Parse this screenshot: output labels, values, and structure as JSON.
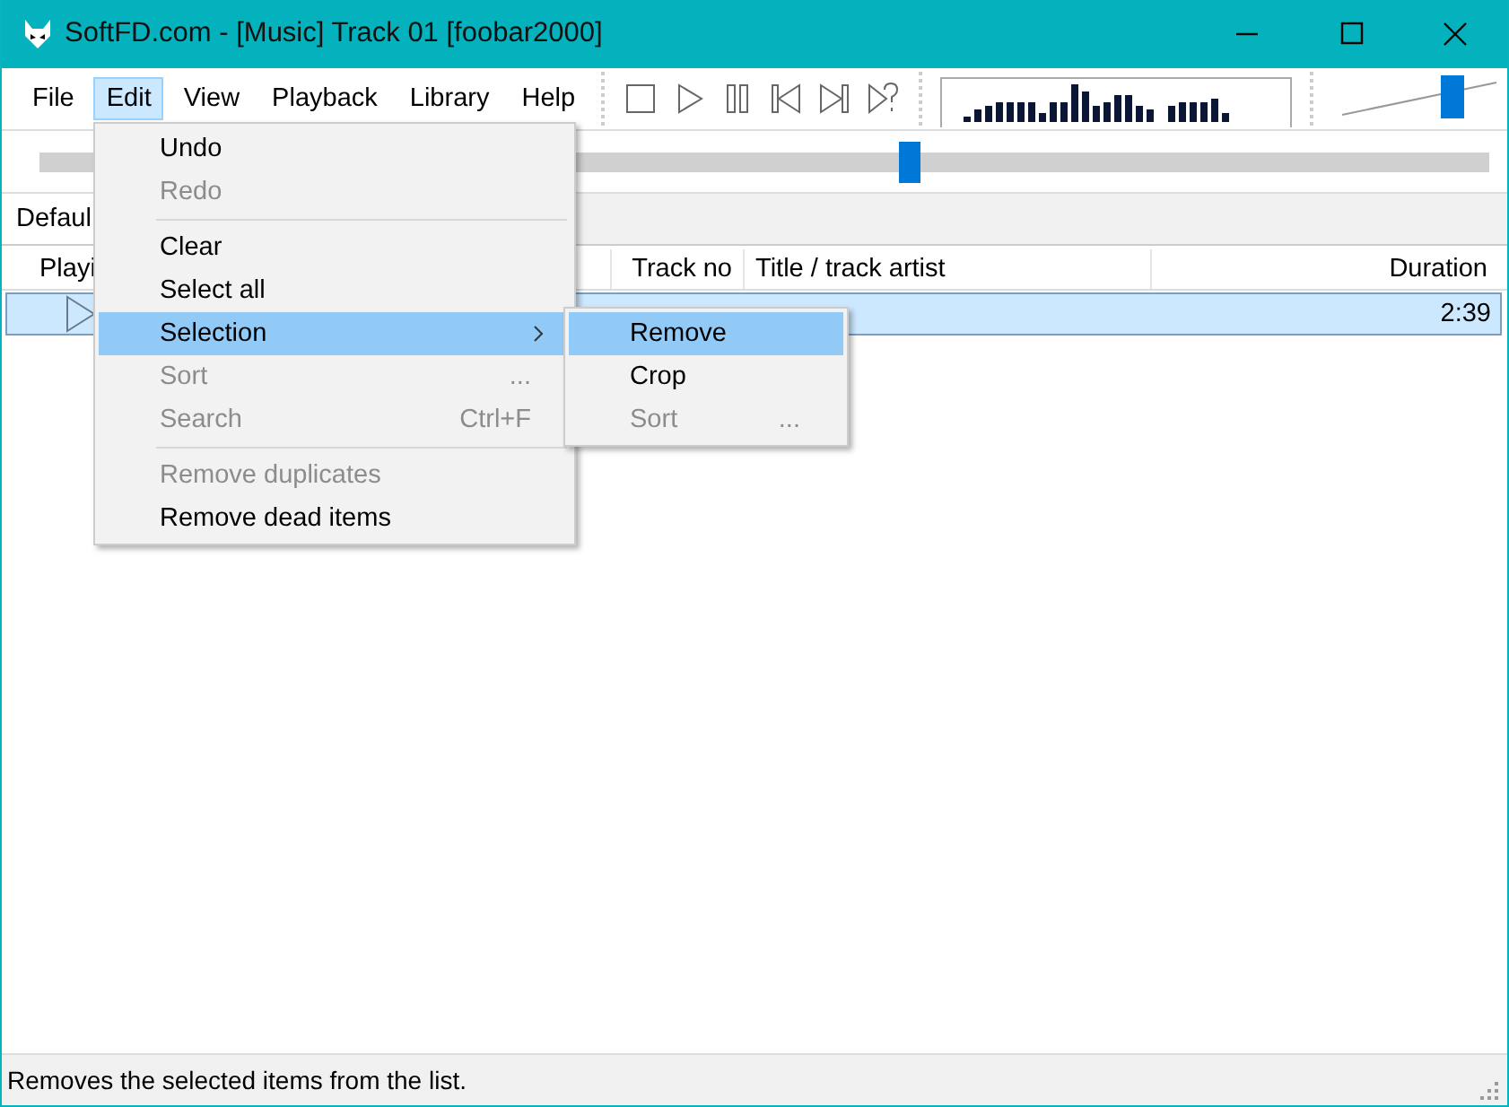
{
  "window": {
    "title": "SoftFD.com - [Music] Track 01  [foobar2000]"
  },
  "menu_bar": [
    {
      "label": "File",
      "selected": false
    },
    {
      "label": "Edit",
      "selected": true
    },
    {
      "label": "View",
      "selected": false
    },
    {
      "label": "Playback",
      "selected": false
    },
    {
      "label": "Library",
      "selected": false
    },
    {
      "label": "Help",
      "selected": false
    }
  ],
  "seek_bar": {
    "level": 0.6
  },
  "volume": {
    "level": 0.75
  },
  "playlist_tabs": [
    {
      "label": "Defaul",
      "selected": true
    }
  ],
  "columns": [
    "Playi",
    "Track no",
    "Title / track artist",
    "Duration"
  ],
  "rows": [
    {
      "selected": true,
      "playing": true,
      "duration": "2:39"
    }
  ],
  "edit_menu": [
    {
      "kind": "item",
      "label": "Undo",
      "disabled": false,
      "selected": false
    },
    {
      "kind": "item",
      "label": "Redo",
      "disabled": true,
      "selected": false
    },
    {
      "kind": "separator"
    },
    {
      "kind": "item",
      "label": "Clear",
      "disabled": false,
      "selected": false
    },
    {
      "kind": "item",
      "label": "Select all",
      "disabled": false,
      "selected": false
    },
    {
      "kind": "item",
      "label": "Selection",
      "disabled": false,
      "selected": true,
      "submenu": true
    },
    {
      "kind": "item",
      "label": "Sort",
      "shortcut": "...",
      "disabled": true,
      "selected": false
    },
    {
      "kind": "item",
      "label": "Search",
      "shortcut": "Ctrl+F",
      "disabled": true,
      "selected": false
    },
    {
      "kind": "separator"
    },
    {
      "kind": "item",
      "label": "Remove duplicates",
      "disabled": true,
      "selected": false
    },
    {
      "kind": "item",
      "label": "Remove dead items",
      "disabled": false,
      "selected": false
    }
  ],
  "selection_submenu": [
    {
      "kind": "item",
      "label": "Remove",
      "disabled": false,
      "selected": true
    },
    {
      "kind": "item",
      "label": "Crop",
      "disabled": false,
      "selected": false
    },
    {
      "kind": "item",
      "label": "Sort",
      "shortcut": "...",
      "disabled": true,
      "selected": false
    }
  ],
  "status_bar": {
    "text": "Removes the selected items from the list."
  }
}
